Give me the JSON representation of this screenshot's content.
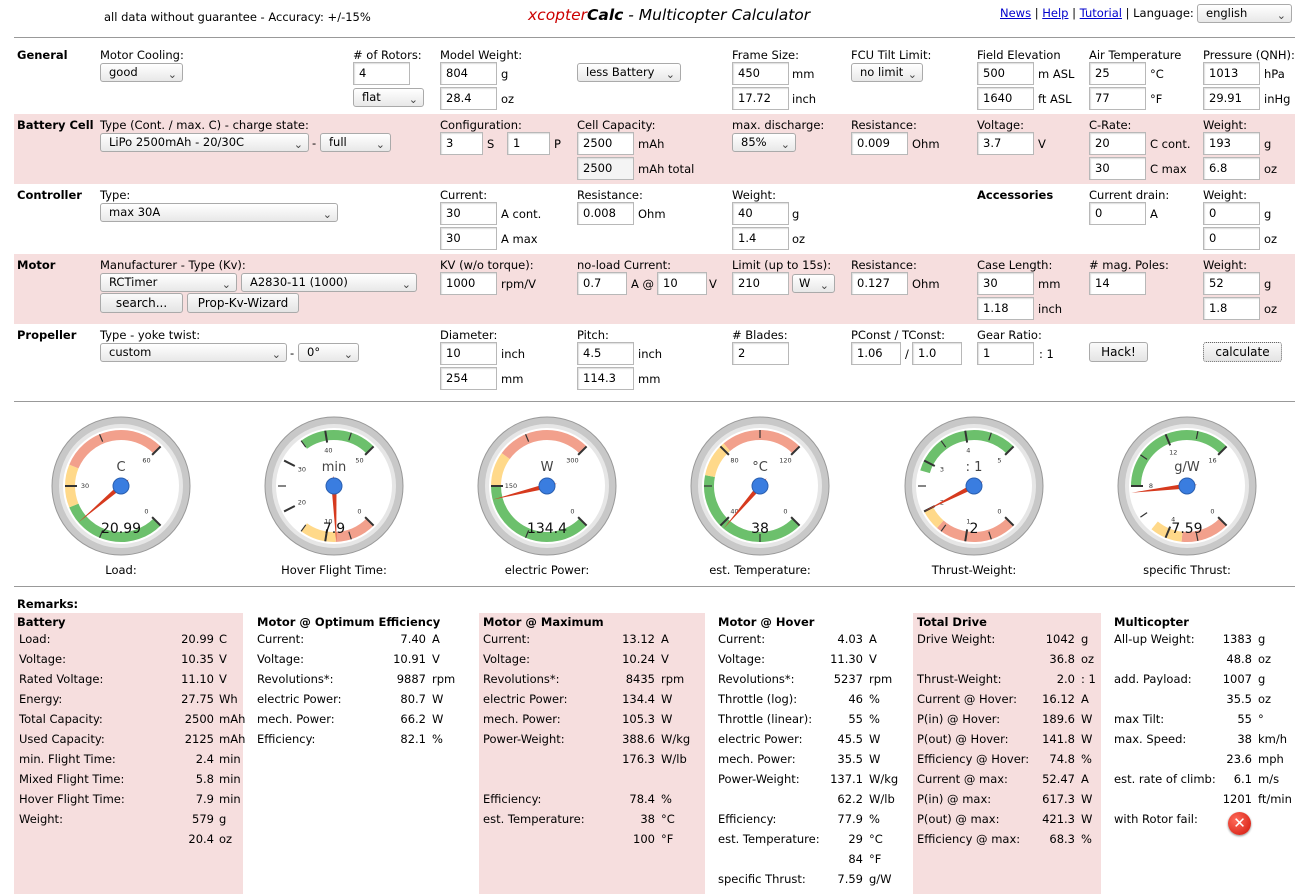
{
  "header": {
    "disclaimer": "all data without guarantee - Accuracy: +/-15%",
    "title_brand_a": "xcopter",
    "title_brand_b": "Calc",
    "title_rest": " - Multicopter Calculator",
    "links": [
      "News",
      "Help",
      "Tutorial"
    ],
    "language_label": "Language:",
    "language_value": "english"
  },
  "colors": {
    "accent_red": "#cc0000",
    "row_pink": "#f6dede",
    "gauge_green": "#6cc06c",
    "gauge_yellow": "#ffd98a",
    "gauge_red": "#f2a08c"
  },
  "general": {
    "label": "General",
    "motor_cooling_label": "Motor Cooling:",
    "motor_cooling": "good",
    "rotors_label": "# of Rotors:",
    "rotors": "4",
    "frame_type": "flat",
    "model_weight_label": "Model Weight:",
    "model_weight_g": "804",
    "model_weight_oz": "28.4",
    "unit_g": "g",
    "unit_oz": "oz",
    "battery_mode": "less Battery",
    "frame_size_label": "Frame Size:",
    "frame_size_mm": "450",
    "frame_size_inch": "17.72",
    "unit_mm": "mm",
    "unit_inch": "inch",
    "fcu_label": "FCU Tilt Limit:",
    "fcu_value": "no limit",
    "elev_label": "Field Elevation",
    "elev_m": "500",
    "elev_ft": "1640",
    "unit_masl": "m ASL",
    "unit_ftasl": "ft ASL",
    "air_label": "Air Temperature",
    "air_c": "25",
    "air_f": "77",
    "unit_c": "°C",
    "unit_f": "°F",
    "press_label": "Pressure (QNH):",
    "press_hpa": "1013",
    "press_inhg": "29.91",
    "unit_hpa": "hPa",
    "unit_inhg": "inHg"
  },
  "battery": {
    "label": "Battery Cell",
    "type_label": "Type (Cont. / max. C) - charge state:",
    "type": "LiPo 2500mAh - 20/30C",
    "charge": "full",
    "config_label": "Configuration:",
    "s": "3",
    "p": "1",
    "unit_s": "S",
    "unit_p": "P",
    "cap_label": "Cell Capacity:",
    "cap": "2500",
    "cap_total": "2500",
    "unit_mah": "mAh",
    "unit_mah_total": "mAh total",
    "maxdis_label": "max. discharge:",
    "maxdis": "85%",
    "res_label": "Resistance:",
    "res": "0.009",
    "unit_ohm": "Ohm",
    "volt_label": "Voltage:",
    "volt": "3.7",
    "unit_v": "V",
    "crate_label": "C-Rate:",
    "c_cont": "20",
    "c_max": "30",
    "unit_ccont": "C cont.",
    "unit_cmax": "C max",
    "weight_label": "Weight:",
    "weight_g": "193",
    "weight_oz": "6.8"
  },
  "controller": {
    "label": "Controller",
    "type_label": "Type:",
    "type": "max 30A",
    "current_label": "Current:",
    "cont": "30",
    "max": "30",
    "unit_acont": "A cont.",
    "unit_amax": "A max",
    "res_label": "Resistance:",
    "res": "0.008",
    "weight_label": "Weight:",
    "weight_g": "40",
    "weight_oz": "1.4",
    "acc_label": "Accessories",
    "drain_label": "Current drain:",
    "drain": "0",
    "unit_a": "A",
    "acc_weight_label": "Weight:",
    "acc_weight_g": "0",
    "acc_weight_oz": "0"
  },
  "motor": {
    "label": "Motor",
    "manu_label": "Manufacturer - Type (Kv):",
    "manu": "RCTimer",
    "type": "A2830-11 (1000)",
    "search": "search...",
    "wizard": "Prop-Kv-Wizard",
    "kv_label": "KV (w/o torque):",
    "kv": "1000",
    "unit_rpmv": "rpm/V",
    "noload_label": "no-load Current:",
    "noload_a": "0.7",
    "noload_v": "10",
    "unit_aat": "A @",
    "limit_label": "Limit (up to 15s):",
    "limit": "210",
    "limit_unit": "W",
    "res_label": "Resistance:",
    "res": "0.127",
    "case_label": "Case Length:",
    "case_mm": "30",
    "case_inch": "1.18",
    "poles_label": "# mag. Poles:",
    "poles": "14",
    "weight_label": "Weight:",
    "weight_g": "52",
    "weight_oz": "1.8"
  },
  "propeller": {
    "label": "Propeller",
    "type_label": "Type - yoke twist:",
    "type": "custom",
    "twist": "0°",
    "dia_label": "Diameter:",
    "dia_inch": "10",
    "dia_mm": "254",
    "pitch_label": "Pitch:",
    "pitch_inch": "4.5",
    "pitch_mm": "114.3",
    "blades_label": "# Blades:",
    "blades": "2",
    "pconst_label": "PConst / TConst:",
    "pconst": "1.06",
    "tconst": "1.0",
    "gear_label": "Gear Ratio:",
    "gear": "1",
    "gear_suffix": ": 1",
    "hack": "Hack!",
    "calculate": "calculate"
  },
  "gauges": [
    {
      "unit": "C",
      "value": "20.99",
      "label": "Load:",
      "min": 0,
      "max": 60,
      "needle": 20.99,
      "ticks": [
        "0",
        "30",
        "60"
      ],
      "bands": [
        {
          "from": 0,
          "to": 25,
          "color": "#6cc06c"
        },
        {
          "from": 25,
          "to": 35,
          "color": "#ffd98a"
        },
        {
          "from": 35,
          "to": 60,
          "color": "#f2a08c"
        }
      ]
    },
    {
      "unit": "min",
      "value": "7.9",
      "label": "Hover Flight Time:",
      "min": 0,
      "max": 50,
      "needle": 7.9,
      "ticks": [
        "0",
        "10",
        "20",
        "30",
        "40",
        "50"
      ],
      "bands": [
        {
          "from": 0,
          "to": 8,
          "color": "#f2a08c"
        },
        {
          "from": 8,
          "to": 15,
          "color": "#ffd98a"
        },
        {
          "from": 35,
          "to": 50,
          "color": "#6cc06c"
        }
      ]
    },
    {
      "unit": "W",
      "value": "134.4",
      "label": "electric Power:",
      "min": 0,
      "max": 300,
      "needle": 134.4,
      "ticks": [
        "0",
        "150",
        "300"
      ],
      "bands": [
        {
          "from": 0,
          "to": 150,
          "color": "#6cc06c"
        },
        {
          "from": 150,
          "to": 190,
          "color": "#ffd98a"
        },
        {
          "from": 190,
          "to": 300,
          "color": "#f2a08c"
        }
      ]
    },
    {
      "unit": "°C",
      "value": "38",
      "label": "est. Temperature:",
      "min": 0,
      "max": 120,
      "needle": 38,
      "ticks": [
        "0",
        "40",
        "80",
        "120"
      ],
      "bands": [
        {
          "from": 0,
          "to": 65,
          "color": "#6cc06c"
        },
        {
          "from": 65,
          "to": 82,
          "color": "#ffd98a"
        },
        {
          "from": 82,
          "to": 120,
          "color": "#f2a08c"
        }
      ]
    },
    {
      "unit": ": 1",
      "value": "2",
      "label": "Thrust-Weight:",
      "min": 0,
      "max": 5,
      "needle": 2,
      "ticks": [
        "0",
        "1",
        "2",
        "3",
        "4",
        "5"
      ],
      "bands": [
        {
          "from": 0,
          "to": 1.6,
          "color": "#f2a08c"
        },
        {
          "from": 1.6,
          "to": 2.0,
          "color": "#ffd98a"
        },
        {
          "from": 2.8,
          "to": 5,
          "color": "#6cc06c"
        }
      ]
    },
    {
      "unit": "g/W",
      "value": "7.59",
      "label": "specific Thrust:",
      "min": 0,
      "max": 16,
      "needle": 7.59,
      "ticks": [
        "0",
        "4",
        "8",
        "12",
        "16"
      ],
      "bands": [
        {
          "from": 0,
          "to": 3,
          "color": "#f2a08c"
        },
        {
          "from": 3,
          "to": 5,
          "color": "#ffd98a"
        },
        {
          "from": 8,
          "to": 16,
          "color": "#6cc06c"
        }
      ]
    }
  ],
  "remarks": {
    "title": "Remarks:",
    "battery": {
      "title": "Battery",
      "rows": [
        [
          "Load:",
          "20.99",
          "C"
        ],
        [
          "Voltage:",
          "10.35",
          "V"
        ],
        [
          "Rated Voltage:",
          "11.10",
          "V"
        ],
        [
          "Energy:",
          "27.75",
          "Wh"
        ],
        [
          "Total Capacity:",
          "2500",
          "mAh"
        ],
        [
          "Used Capacity:",
          "2125",
          "mAh"
        ],
        [
          "min. Flight Time:",
          "2.4",
          "min"
        ],
        [
          "Mixed Flight Time:",
          "5.8",
          "min"
        ],
        [
          "Hover Flight Time:",
          "7.9",
          "min"
        ],
        [
          "Weight:",
          "579",
          "g"
        ],
        [
          "",
          "20.4",
          "oz"
        ]
      ]
    },
    "opt": {
      "title": "Motor @ Optimum Efficiency",
      "rows": [
        [
          "Current:",
          "7.40",
          "A"
        ],
        [
          "Voltage:",
          "10.91",
          "V"
        ],
        [
          "Revolutions*:",
          "9887",
          "rpm"
        ],
        [
          "electric Power:",
          "80.7",
          "W"
        ],
        [
          "mech. Power:",
          "66.2",
          "W"
        ],
        [
          "Efficiency:",
          "82.1",
          "%"
        ]
      ]
    },
    "max": {
      "title": "Motor @ Maximum",
      "rows": [
        [
          "Current:",
          "13.12",
          "A"
        ],
        [
          "Voltage:",
          "10.24",
          "V"
        ],
        [
          "Revolutions*:",
          "8435",
          "rpm"
        ],
        [
          "electric Power:",
          "134.4",
          "W"
        ],
        [
          "mech. Power:",
          "105.3",
          "W"
        ],
        [
          "Power-Weight:",
          "388.6",
          "W/kg"
        ],
        [
          "",
          "176.3",
          "W/lb"
        ],
        [
          "",
          "",
          " "
        ],
        [
          "Efficiency:",
          "78.4",
          "%"
        ],
        [
          "est. Temperature:",
          "38",
          "°C"
        ],
        [
          "",
          "100",
          "°F"
        ]
      ]
    },
    "hover": {
      "title": "Motor @ Hover",
      "rows": [
        [
          "Current:",
          "4.03",
          "A"
        ],
        [
          "Voltage:",
          "11.30",
          "V"
        ],
        [
          "Revolutions*:",
          "5237",
          "rpm"
        ],
        [
          "Throttle (log):",
          "46",
          "%"
        ],
        [
          "Throttle (linear):",
          "55",
          "%"
        ],
        [
          "electric Power:",
          "45.5",
          "W"
        ],
        [
          "mech. Power:",
          "35.5",
          "W"
        ],
        [
          "Power-Weight:",
          "137.1",
          "W/kg"
        ],
        [
          "",
          "62.2",
          "W/lb"
        ],
        [
          "Efficiency:",
          "77.9",
          "%"
        ],
        [
          "est. Temperature:",
          "29",
          "°C"
        ],
        [
          "",
          "84",
          "°F"
        ],
        [
          "specific Thrust:",
          "7.59",
          "g/W"
        ]
      ]
    },
    "drive": {
      "title": "Total Drive",
      "rows": [
        [
          "Drive Weight:",
          "1042",
          "g"
        ],
        [
          "",
          "36.8",
          "oz"
        ],
        [
          "Thrust-Weight:",
          "2.0",
          ": 1"
        ],
        [
          "Current @ Hover:",
          "16.12",
          "A"
        ],
        [
          "P(in) @ Hover:",
          "189.6",
          "W"
        ],
        [
          "P(out) @ Hover:",
          "141.8",
          "W"
        ],
        [
          "Efficiency @ Hover:",
          "74.8",
          "%"
        ],
        [
          "Current @ max:",
          "52.47",
          "A"
        ],
        [
          "P(in) @ max:",
          "617.3",
          "W"
        ],
        [
          "P(out) @ max:",
          "421.3",
          "W"
        ],
        [
          "Efficiency @ max:",
          "68.3",
          "%"
        ]
      ]
    },
    "multi": {
      "title": "Multicopter",
      "rows": [
        [
          "All-up Weight:",
          "1383",
          "g"
        ],
        [
          "",
          "48.8",
          "oz"
        ],
        [
          "add. Payload:",
          "1007",
          "g"
        ],
        [
          "",
          "35.5",
          "oz"
        ],
        [
          "max Tilt:",
          "55",
          "°"
        ],
        [
          "max. Speed:",
          "38",
          "km/h"
        ],
        [
          "",
          "23.6",
          "mph"
        ],
        [
          "est. rate of climb:",
          "6.1",
          "m/s"
        ],
        [
          "",
          "1201",
          "ft/min"
        ],
        [
          "with Rotor fail:",
          "",
          ""
        ]
      ]
    }
  }
}
